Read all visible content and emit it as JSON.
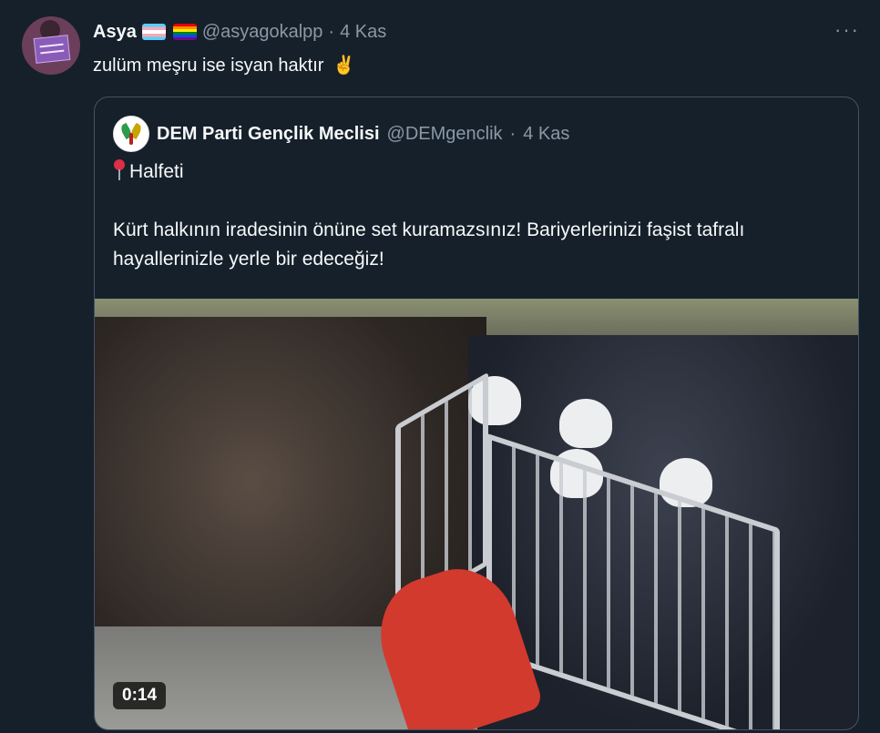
{
  "tweet": {
    "author_name": "Asya",
    "flags": [
      "transgender-flag",
      "rainbow-flag"
    ],
    "handle": "@asyagokalpp",
    "separator": "·",
    "date": "4 Kas",
    "text": "zulüm meşru ise isyan haktır",
    "emoji": "✌️",
    "more_icon": "more-options-icon"
  },
  "quoted": {
    "author_name": "DEM Parti Gençlik Meclisi",
    "handle": "@DEMgenclik",
    "separator": "·",
    "date": "4 Kas",
    "location_line": "Halfeti",
    "body": "Kürt halkının iradesinin önüne set kuramazsınız! Bariyerlerinizi faşist tafralı hayallerinizle yerle bir edeceğiz!",
    "video": {
      "duration": "0:14"
    }
  },
  "colors": {
    "background": "#15202b",
    "muted": "#8b98a5",
    "border": "#425364"
  }
}
